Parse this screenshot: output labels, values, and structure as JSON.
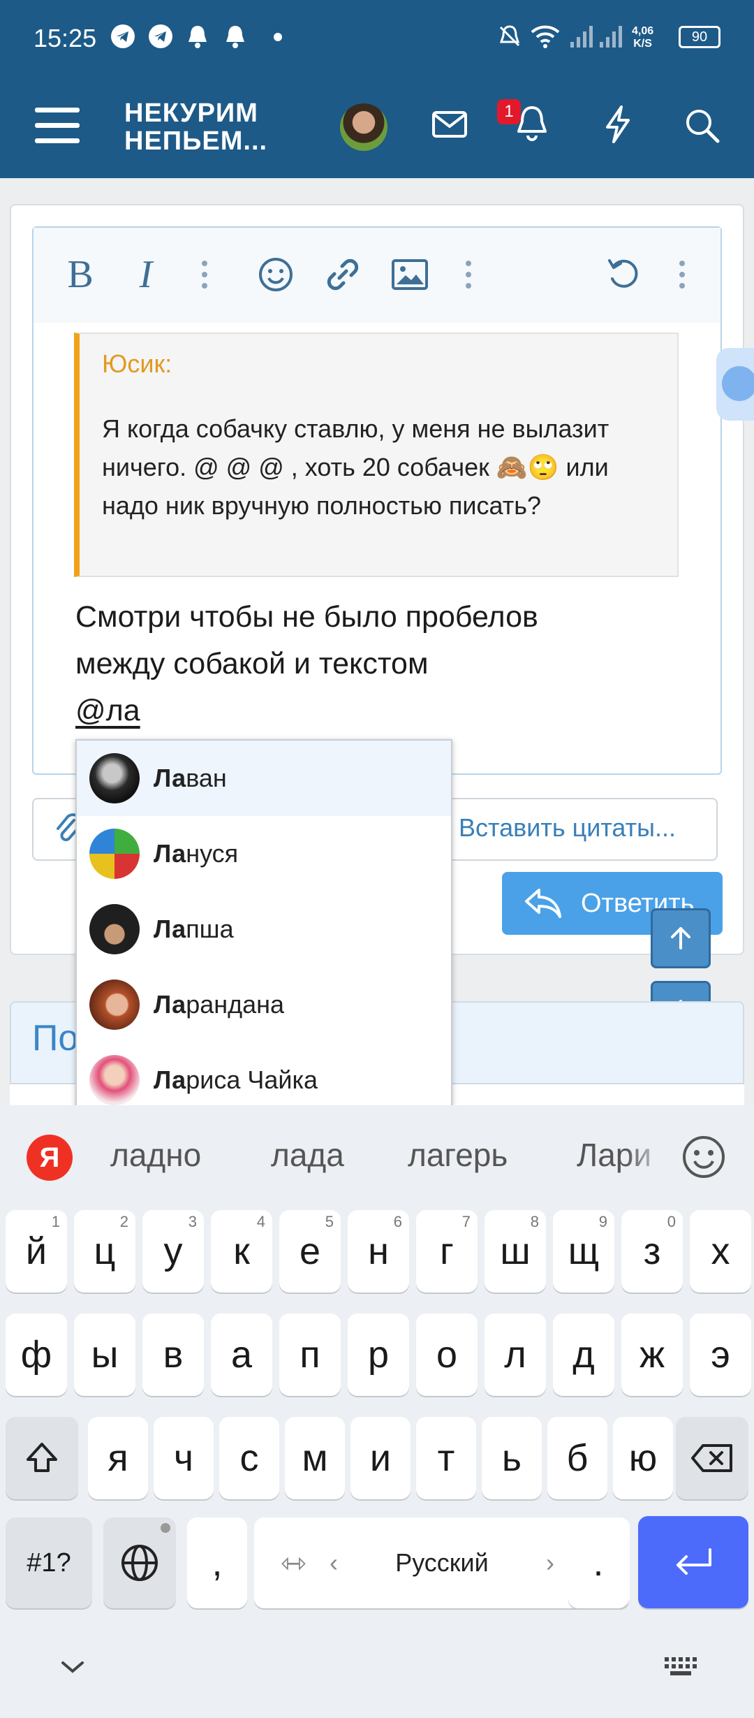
{
  "status_bar": {
    "time": "15:25",
    "net_speed_value": "4,06",
    "net_speed_unit": "K/S",
    "battery": "90"
  },
  "header": {
    "logo_line1": "НЕКУРИМ",
    "logo_line2": "НЕПЬЕМ...",
    "notifications_badge": "1"
  },
  "editor": {
    "quote_author": "Юсик:",
    "quote_text": "Я когда собачку ставлю, у меня не вылазит ничего. @ @ @ , хоть 20 собачек 🙈🙄 или надо ник вручную полностью писать?",
    "body_line1": "Смотри чтобы не было пробелов",
    "body_line2": "между собакой и текстом",
    "mention_text": "@ла"
  },
  "actions": {
    "insert_quotes": "Вставить цитаты...",
    "reply": "Ответить"
  },
  "second_card_title": "По",
  "mention_suggestions": [
    {
      "prefix": "Ла",
      "rest": "ван"
    },
    {
      "prefix": "Ла",
      "rest": "нуся"
    },
    {
      "prefix": "Ла",
      "rest": "пша"
    },
    {
      "prefix": "Ла",
      "rest": "рандана"
    },
    {
      "prefix": "Ла",
      "rest": "риса Чайка"
    }
  ],
  "keyboard": {
    "suggestions": [
      "ладно",
      "лада",
      "лагерь",
      "Лари"
    ],
    "row1": [
      "й",
      "ц",
      "у",
      "к",
      "е",
      "н",
      "г",
      "ш",
      "щ",
      "з",
      "х"
    ],
    "row1_hints": [
      "1",
      "2",
      "3",
      "4",
      "5",
      "6",
      "7",
      "8",
      "9",
      "0",
      ""
    ],
    "row2": [
      "ф",
      "ы",
      "в",
      "а",
      "п",
      "р",
      "о",
      "л",
      "д",
      "ж",
      "э"
    ],
    "row3": [
      "я",
      "ч",
      "с",
      "м",
      "и",
      "т",
      "ь",
      "б",
      "ю"
    ],
    "symbols_key": "#1?",
    "comma_key": ",",
    "period_key": ".",
    "language": "Русский",
    "yandex_letter": "Я"
  }
}
